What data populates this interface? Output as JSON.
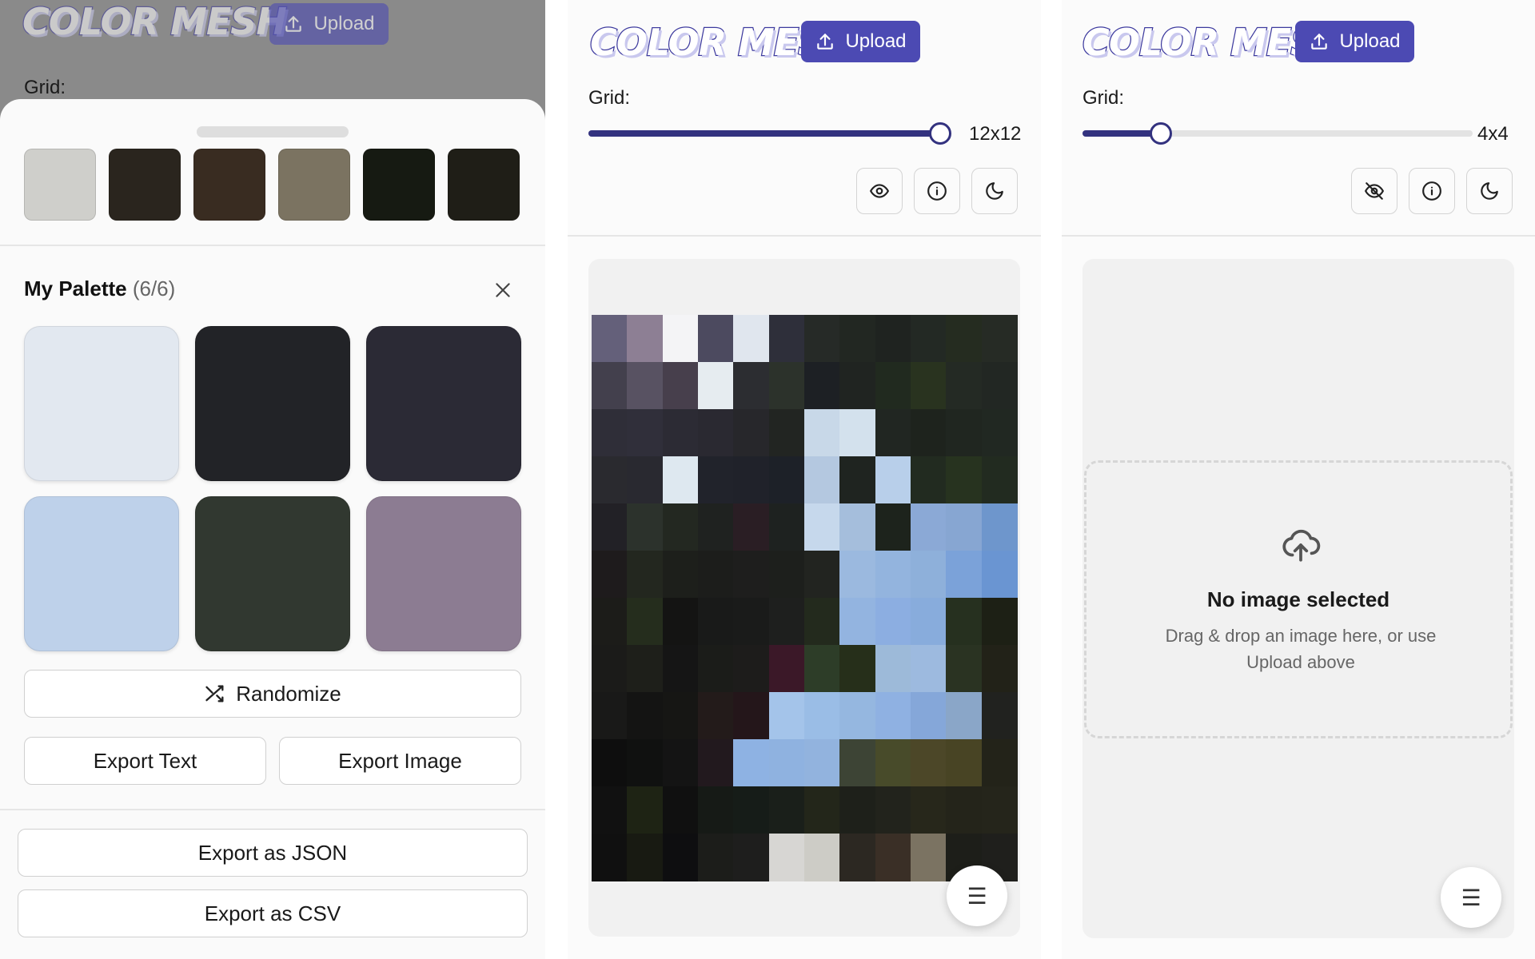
{
  "app": {
    "logo_text": "COLOR MESH",
    "upload_label": "Upload",
    "grid_label": "Grid:"
  },
  "panel_palette": {
    "extracted_swatches": [
      "#cfcfcb",
      "#2a251e",
      "#392c21",
      "#7b7361",
      "#161a12",
      "#1f1e17"
    ],
    "palette_title": "My Palette",
    "palette_count": "(6/6)",
    "palette_colors": [
      "#e2e8f0",
      "#222327",
      "#2b2a35",
      "#bed1ea",
      "#313830",
      "#8c7c92"
    ],
    "randomize_label": "Randomize",
    "export_text_label": "Export Text",
    "export_image_label": "Export Image",
    "export_json_label": "Export as JSON",
    "export_csv_label": "Export as CSV"
  },
  "panel_image": {
    "grid_value": "12x12",
    "slider_fraction": 1.0,
    "mosaic_rows": [
      [
        "#64607a",
        "#8d7f94",
        "#f4f4f6",
        "#4c4a5f",
        "#e0e6ee",
        "#2e2f3a",
        "#262a27",
        "#222722",
        "#1f2320",
        "#232924",
        "#252c20",
        "#262b25"
      ],
      [
        "#43404d",
        "#585262",
        "#473f4c",
        "#e6ecf0",
        "#2c2d31",
        "#2c322b",
        "#1d2024",
        "#202421",
        "#212a1f",
        "#29331f",
        "#242a24",
        "#222723"
      ],
      [
        "#2f2e38",
        "#302f3a",
        "#2c2b34",
        "#2a2931",
        "#27272b",
        "#222522",
        "#c8d8e8",
        "#d3e1ed",
        "#212622",
        "#1e231d",
        "#202620",
        "#212822"
      ],
      [
        "#2a2a2f",
        "#292930",
        "#dee8f0",
        "#21232b",
        "#20222a",
        "#1d2128",
        "#b4c8e0",
        "#1f2420",
        "#b8cfea",
        "#222b20",
        "#27331f",
        "#222b20"
      ],
      [
        "#222126",
        "#2c322c",
        "#232821",
        "#1f2220",
        "#2a1e24",
        "#1e2220",
        "#c6d8ec",
        "#a5bedc",
        "#1d231c",
        "#8ba9d6",
        "#87a6d2",
        "#6e96cc"
      ],
      [
        "#1e1b1c",
        "#23271f",
        "#1d1f1b",
        "#1c1d1b",
        "#1e1e1d",
        "#1d1f1c",
        "#222420",
        "#9bb9df",
        "#93b4de",
        "#8eb0da",
        "#7ba2d9",
        "#6a95d2"
      ],
      [
        "#1c1c19",
        "#252d1d",
        "#141413",
        "#191a19",
        "#1a1b1a",
        "#1e1f1e",
        "#232a1d",
        "#93b4e0",
        "#8caee1",
        "#88acdc",
        "#26301f",
        "#1d2015"
      ],
      [
        "#1b1b19",
        "#1e1f1a",
        "#151515",
        "#1b1c19",
        "#1d1c1b",
        "#3b1828",
        "#2d3d28",
        "#262f1a",
        "#9dbad9",
        "#9dbadf",
        "#2a3322",
        "#222218"
      ],
      [
        "#191918",
        "#141413",
        "#161614",
        "#231b1a",
        "#24161a",
        "#a4c4ea",
        "#9abde6",
        "#95b7e0",
        "#8fb1e2",
        "#85a7d9",
        "#8aa6c8",
        "#21221f"
      ],
      [
        "#0e0e0e",
        "#101110",
        "#141414",
        "#22191e",
        "#8eb2e3",
        "#8fb2e0",
        "#92b3de",
        "#3d4435",
        "#484b2a",
        "#4c4728",
        "#484424",
        "#232319"
      ],
      [
        "#111111",
        "#1e2314",
        "#101010",
        "#161a16",
        "#161c18",
        "#1a1f1a",
        "#23261a",
        "#1e201a",
        "#22231c",
        "#27271b",
        "#24241a",
        "#25251b"
      ],
      [
        "#101010",
        "#181a12",
        "#0e0e10",
        "#1c1d1a",
        "#1e1e1d",
        "#d7d6d3",
        "#cdccc6",
        "#2c2822",
        "#3a2f26",
        "#7b7362",
        "#1d1e19",
        "#1f1f1c"
      ]
    ]
  },
  "panel_empty": {
    "grid_value": "4x4",
    "slider_fraction": 0.2,
    "no_image_title": "No image selected",
    "no_image_hint": "Drag & drop an image here, or use Upload above"
  }
}
